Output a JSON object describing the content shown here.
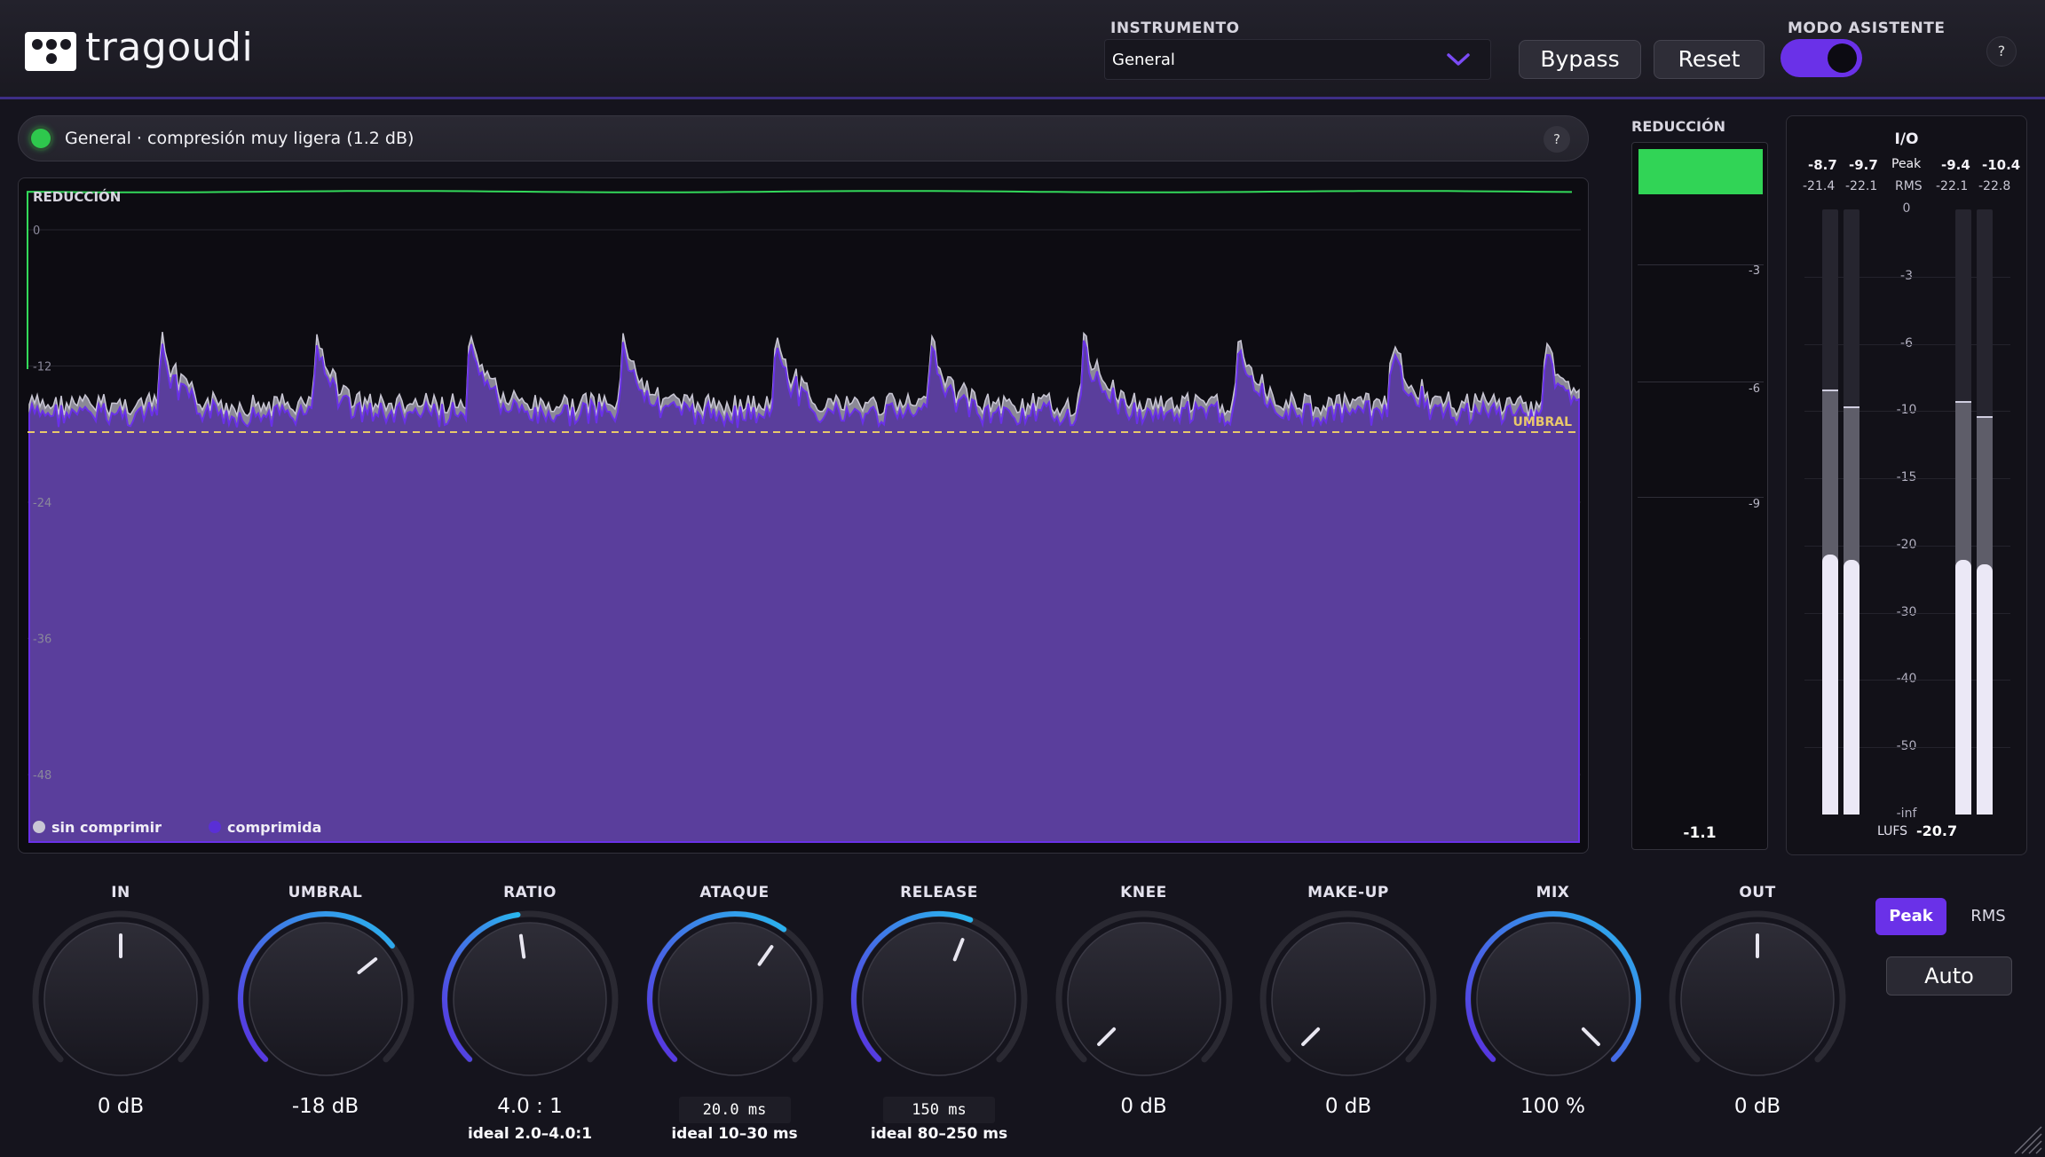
{
  "app": {
    "logo_text": "tragoudi"
  },
  "header": {
    "instrument_label": "INSTRUMENTO",
    "instrument_value": "General",
    "bypass_label": "Bypass",
    "reset_label": "Reset",
    "assistant_label": "MODO ASISTENTE",
    "assistant_on": true,
    "help_label": "?"
  },
  "status": {
    "text": "General · compresión muy ligera (1.2 dB)",
    "led_color": "#2ec84d",
    "help_label": "?"
  },
  "graph": {
    "title": "REDUCCIÓN",
    "y_ticks": [
      "0",
      "-12",
      "-24",
      "-36",
      "-48"
    ],
    "threshold_label": "UMBRAL",
    "legend": [
      {
        "label": "sin comprimir",
        "color": "#c9c7d4"
      },
      {
        "label": "comprimida",
        "color": "#5a2fd6"
      }
    ],
    "accent_color": "#6a31e8",
    "threshold_color": "#e8c86a"
  },
  "reduction": {
    "label": "REDUCCIÓN",
    "ticks": [
      "-3",
      "-6",
      "-9"
    ],
    "value": "-1.1",
    "fill_color": "#31d456"
  },
  "io": {
    "title": "I/O",
    "in_peak": [
      "-8.7",
      "-9.7"
    ],
    "out_peak": [
      "-9.4",
      "-10.4"
    ],
    "in_rms": [
      "-21.4",
      "-22.1"
    ],
    "out_rms": [
      "-22.1",
      "-22.8"
    ],
    "peak_label": "Peak",
    "rms_label": "RMS",
    "scale": [
      "0",
      "-3",
      "-6",
      "-10",
      "-15",
      "-20",
      "-30",
      "-40",
      "-50",
      "-inf"
    ],
    "lufs_label": "LUFS",
    "lufs_value": "-20.7"
  },
  "knobs": [
    {
      "label": "IN",
      "value": "0 dB",
      "fraction": 0.5,
      "arc": false
    },
    {
      "label": "UMBRAL",
      "value": "-18 dB",
      "fraction": 0.69,
      "arc": true
    },
    {
      "label": "RATIO",
      "value": "4.0 : 1",
      "ideal": "ideal 2.0–4.0:1",
      "fraction": 0.47,
      "arc": true
    },
    {
      "label": "ATAQUE",
      "value": "20.0 ms",
      "boxed": true,
      "ideal": "ideal 10–30 ms",
      "fraction": 0.63,
      "arc": true
    },
    {
      "label": "RELEASE",
      "value": "150 ms",
      "boxed": true,
      "ideal": "ideal 80–250 ms",
      "fraction": 0.58,
      "arc": true
    },
    {
      "label": "KNEE",
      "value": "0 dB",
      "fraction": 0.0,
      "arc": false
    },
    {
      "label": "MAKE-UP",
      "value": "0 dB",
      "fraction": 0.0,
      "arc": false
    },
    {
      "label": "MIX",
      "value": "100 %",
      "fraction": 1.0,
      "arc": true
    },
    {
      "label": "OUT",
      "value": "0 dB",
      "fraction": 0.5,
      "arc": false
    }
  ],
  "meter_mode": {
    "peak_label": "Peak",
    "rms_label": "RMS",
    "active": "Peak"
  },
  "auto_label": "Auto"
}
